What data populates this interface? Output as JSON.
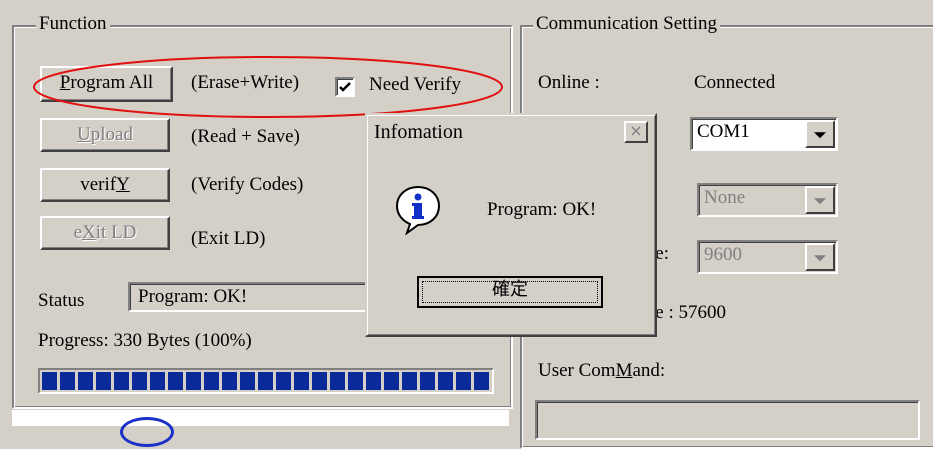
{
  "function_group": {
    "title": "Function",
    "buttons": [
      {
        "label_pre": "",
        "label_u": "P",
        "label_post": "rogram All",
        "desc": "(Erase+Write)",
        "enabled": true
      },
      {
        "label_pre": "",
        "label_u": "U",
        "label_post": "pload",
        "desc": "(Read + Save)",
        "enabled": false
      },
      {
        "label_pre": "verif",
        "label_u": "Y",
        "label_post": "",
        "desc": "(Verify Codes)",
        "enabled": true
      },
      {
        "label_pre": "e",
        "label_u": "X",
        "label_post": "it LD",
        "desc": "(Exit LD)",
        "enabled": false
      }
    ],
    "need_verify_label": "Need Verify",
    "need_verify_checked": true,
    "status_label": "Status",
    "status_value": "Program:  OK!",
    "progress_text": "Progress:  330 Bytes (100%)",
    "progress_fraction": 1.0
  },
  "comm_group": {
    "title": "Communication Setting",
    "online_label": "Online :",
    "online_value": "Connected",
    "port_value": "COM1",
    "parity_value": "None",
    "baud_label_fragment": "te:",
    "baud_value": "9600",
    "rate_fragment": "te : 57600",
    "user_command_pre": "User Com",
    "user_command_u": "M",
    "user_command_post": "and:"
  },
  "dialog": {
    "title": "Infomation",
    "message": "Program:  OK!",
    "ok_label": "確定",
    "close_glyph": "×",
    "icon": "info-icon"
  },
  "annotation": {
    "shape": "red-ellipse",
    "color": "#e01010"
  }
}
